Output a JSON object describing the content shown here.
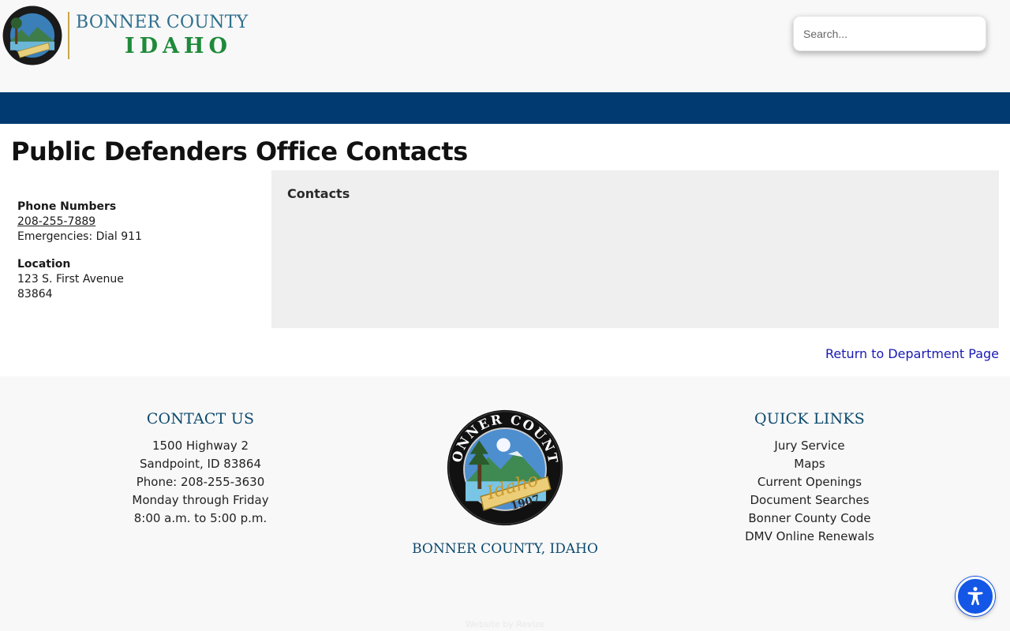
{
  "header": {
    "logo_county": "BONNER COUNTY",
    "logo_state": "IDAHO",
    "seal_top_text": "BONNER COUNTY",
    "seal_script_text": "Idaho",
    "seal_year": "1907"
  },
  "search": {
    "placeholder": "Search..."
  },
  "main": {
    "title": "Public Defenders Office Contacts",
    "phone_label": "Phone Numbers",
    "phone_number": "208-255-7889",
    "emergency": "Emergencies: Dial 911",
    "location_label": "Location",
    "address_line1": "123 S. First Avenue",
    "address_zip": "83864",
    "contacts_heading": "Contacts",
    "return_link": "Return to Department Page"
  },
  "footer": {
    "contact_heading": "CONTACT US",
    "contact_lines": [
      "1500 Highway 2",
      "Sandpoint, ID 83864",
      "Phone: 208-255-3630",
      "Monday through Friday",
      "8:00 a.m. to 5:00 p.m."
    ],
    "seal_caption": "BONNER COUNTY, IDAHO",
    "links_heading": "QUICK LINKS",
    "links": [
      "Jury Service",
      "Maps",
      "Current Openings",
      "Document Searches",
      "Bonner County Code",
      "DMV Online Renewals"
    ],
    "credit": "Website by Revize"
  },
  "colors": {
    "navbar": "#003a70",
    "footer_heading": "#0d4a6e",
    "link": "#1a1ab4",
    "accessibility_button": "#1456e6"
  },
  "icons": {
    "accessibility": "accessibility-person-icon",
    "seal": "county-seal-icon"
  }
}
